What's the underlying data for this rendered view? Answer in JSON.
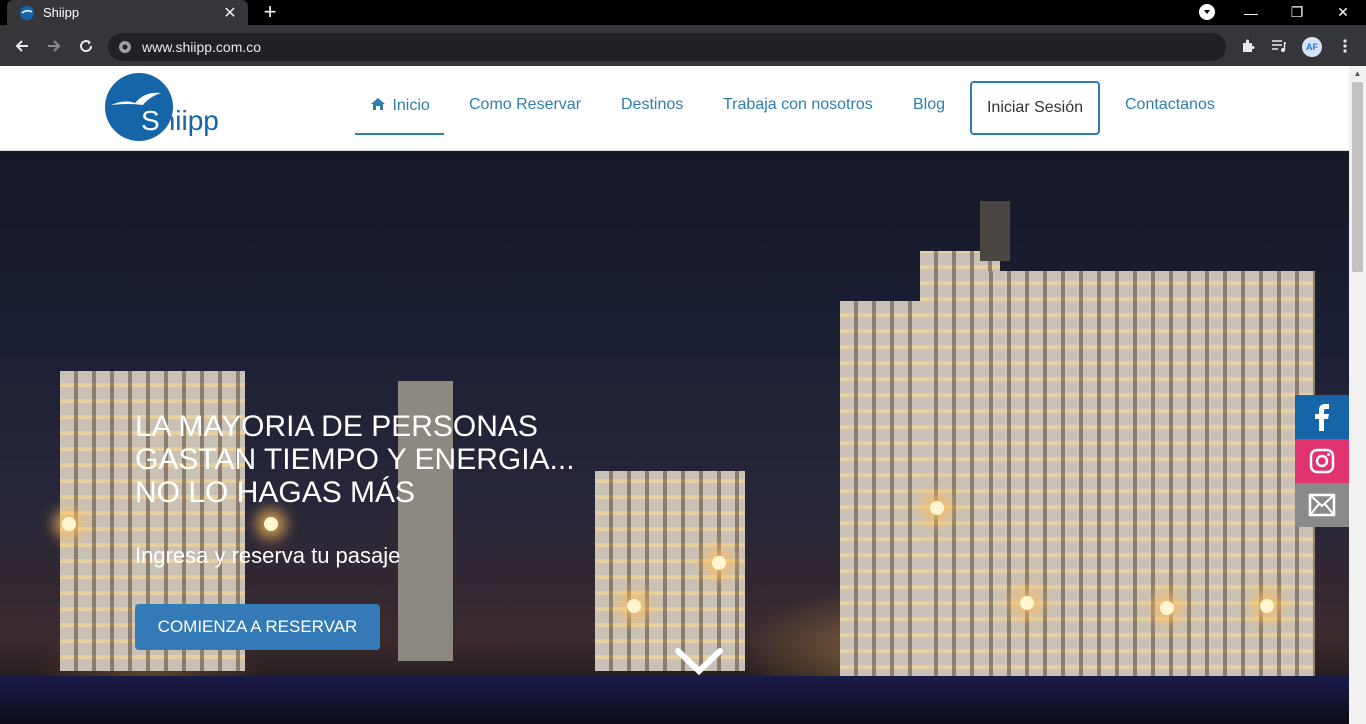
{
  "browser": {
    "tab_title": "Shiipp",
    "url": "www.shiipp.com.co",
    "avatar_initials": "AF",
    "window_controls": [
      "—",
      "❐",
      "✕"
    ]
  },
  "site": {
    "logo_text_first": "S",
    "logo_text_rest": "hiipp",
    "nav": {
      "inicio": "Inicio",
      "como_reservar": "Como Reservar",
      "destinos": "Destinos",
      "trabaja": "Trabaja con nosotros",
      "blog": "Blog",
      "login": "Iniciar Sesión",
      "contactanos": "Contactanos"
    }
  },
  "hero": {
    "heading_line1": "LA MAYORIA DE PERSONAS",
    "heading_line2": "GASTAN TIEMPO Y ENERGIA...",
    "heading_line3": "NO LO HAGAS MÁS",
    "subtitle": "Ingresa y reserva tu pasaje",
    "cta_label": "COMIENZA A RESERVAR"
  },
  "social": {
    "facebook_icon": "facebook-icon",
    "instagram_icon": "instagram-icon",
    "mail_icon": "mail-icon",
    "colors": {
      "facebook": "#1565a8",
      "instagram": "#e0336f",
      "mail": "#8a8a8a"
    }
  },
  "colors": {
    "brand": "#1565a8",
    "nav_link": "#2e7fae",
    "cta": "#337ab7"
  }
}
